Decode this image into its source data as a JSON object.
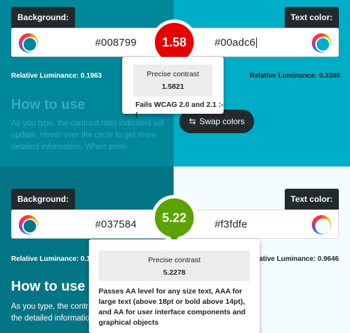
{
  "panels": [
    {
      "labels": {
        "background": "Background:",
        "text_color": "Text color:"
      },
      "background_hex": "#008799",
      "text_hex": "#00adc6",
      "colors": {
        "left_bg": "#008799",
        "right_bg": "#00adc6"
      },
      "contrast_badge": "1.58",
      "luminance": {
        "left": "Relative Luminance: 0.1963",
        "right": "Relative Luminance: 0.3396"
      },
      "how_to_use": "How to use",
      "help_text": "As you type, the contrast ratio indicated will update. Hover over the circle to get more detailed information. When semi-",
      "swap_button": "Swap colors",
      "swap_icon": "⇆",
      "tooltip": {
        "title": "Precise contrast",
        "value": "1.5821",
        "message": "Fails WCAG 2.0 and 2.1 :-("
      }
    },
    {
      "labels": {
        "background": "Background:",
        "text_color": "Text color:"
      },
      "background_hex": "#037584",
      "text_hex": "#f3fdfe",
      "colors": {
        "left_bg": "#037584",
        "right_bg": "#f3fdfe"
      },
      "contrast_badge": "5.22",
      "luminance": {
        "left": "Relative Luminance: 0.14",
        "right": "ative Luminance: 0.9646"
      },
      "how_to_use": "How to use",
      "help_text": "As you type, the contrast update. Hover over the detailed information.",
      "tooltip": {
        "title": "Precise contrast",
        "value": "5.2278",
        "message": "Passes AA level for any size text, AAA for large text (above 18pt or bold above 14pt), and AA for user interface components and graphical objects"
      }
    }
  ]
}
